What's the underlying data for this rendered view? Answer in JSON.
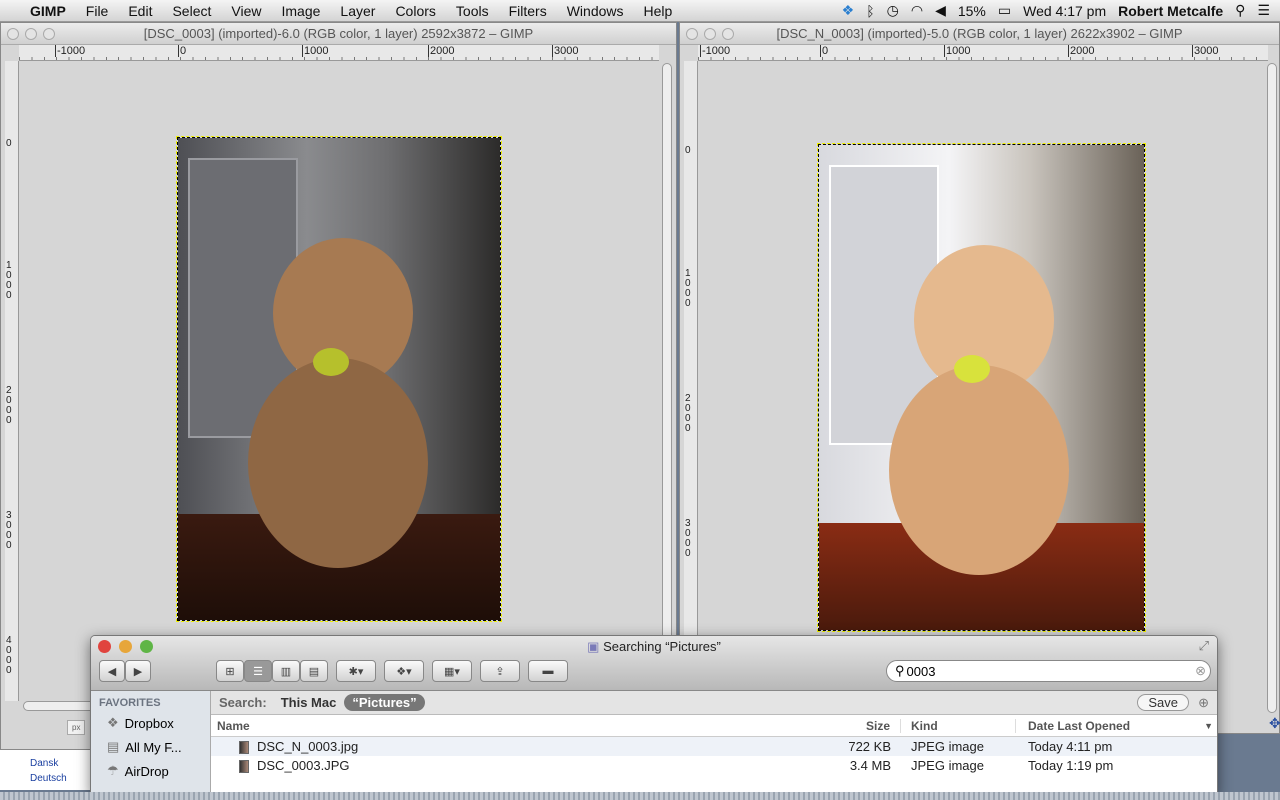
{
  "menubar": {
    "app": "GIMP",
    "items": [
      "File",
      "Edit",
      "Select",
      "View",
      "Image",
      "Layer",
      "Colors",
      "Tools",
      "Filters",
      "Windows",
      "Help"
    ],
    "battery": "15%",
    "clock": "Wed 4:17 pm",
    "user": "Robert Metcalfe"
  },
  "left_window": {
    "title": "[DSC_0003] (imported)-6.0 (RGB color, 1 layer) 2592x3872 – GIMP",
    "hticks": [
      "-1000",
      "0",
      "1000",
      "2000",
      "3000"
    ],
    "vticks": [
      "0",
      "1000",
      "2000",
      "3000",
      "4000"
    ],
    "unit": "px"
  },
  "right_window": {
    "title": "[DSC_N_0003] (imported)-5.0 (RGB color, 1 layer) 2622x3902 – GIMP",
    "hticks": [
      "-1000",
      "0",
      "1000",
      "2000",
      "3000"
    ],
    "vticks": [
      "0",
      "1000",
      "2000",
      "3000"
    ]
  },
  "background_links": [
    "Dansk",
    "Deutsch"
  ],
  "finder": {
    "title": "Searching “Pictures”",
    "search_value": "0003",
    "scope_label": "Search:",
    "scope_this_mac": "This Mac",
    "scope_pictures": "“Pictures”",
    "save": "Save",
    "sidebar_header": "FAVORITES",
    "sidebar": [
      "Dropbox",
      "All My F...",
      "AirDrop"
    ],
    "columns": {
      "name": "Name",
      "size": "Size",
      "kind": "Kind",
      "date": "Date Last Opened"
    },
    "rows": [
      {
        "name": "DSC_N_0003.jpg",
        "size": "722 KB",
        "kind": "JPEG image",
        "date": "Today 4:11 pm"
      },
      {
        "name": "DSC_0003.JPG",
        "size": "3.4 MB",
        "kind": "JPEG image",
        "date": "Today 1:19 pm"
      }
    ]
  }
}
